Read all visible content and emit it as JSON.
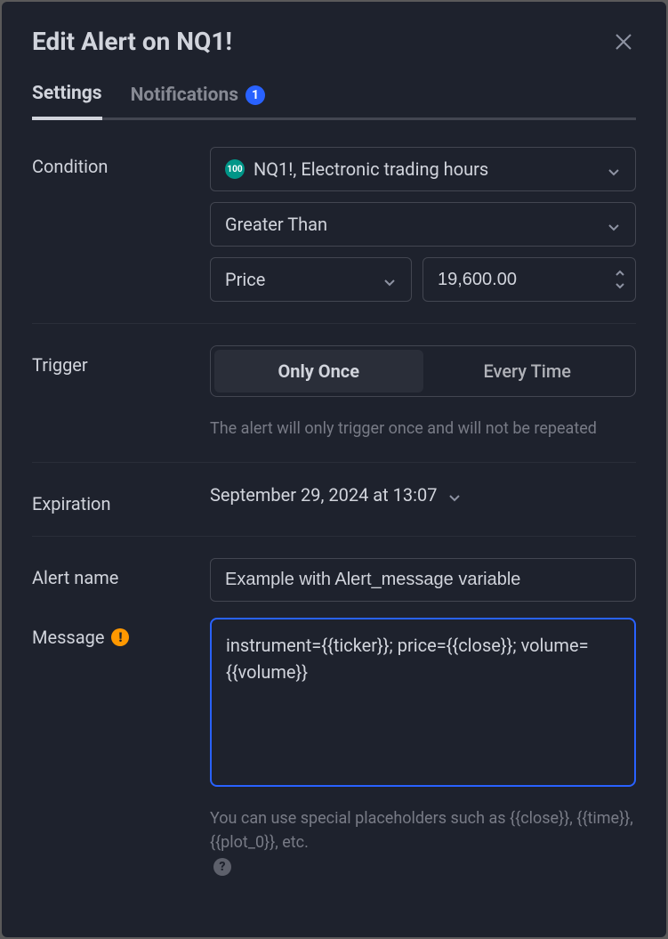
{
  "header": {
    "title": "Edit Alert on NQ1!"
  },
  "tabs": {
    "settings": "Settings",
    "notifications": "Notifications",
    "notifications_badge": "1"
  },
  "condition": {
    "label": "Condition",
    "symbol_badge": "100",
    "symbol_text": "NQ1!, Electronic trading hours",
    "operator": "Greater Than",
    "type": "Price",
    "value": "19,600.00"
  },
  "trigger": {
    "label": "Trigger",
    "opt_once": "Only Once",
    "opt_every": "Every Time",
    "helper": "The alert will only trigger once and will not be repeated"
  },
  "expiration": {
    "label": "Expiration",
    "value": "September 29, 2024 at 13:07"
  },
  "alert_name": {
    "label": "Alert name",
    "value": "Example with Alert_message variable"
  },
  "message": {
    "label": "Message",
    "value": "instrument={{ticker}}; price={{close}}; volume={{volume}}",
    "helper": "You can use special placeholders such as {{close}}, {{time}}, {{plot_0}}, etc."
  }
}
